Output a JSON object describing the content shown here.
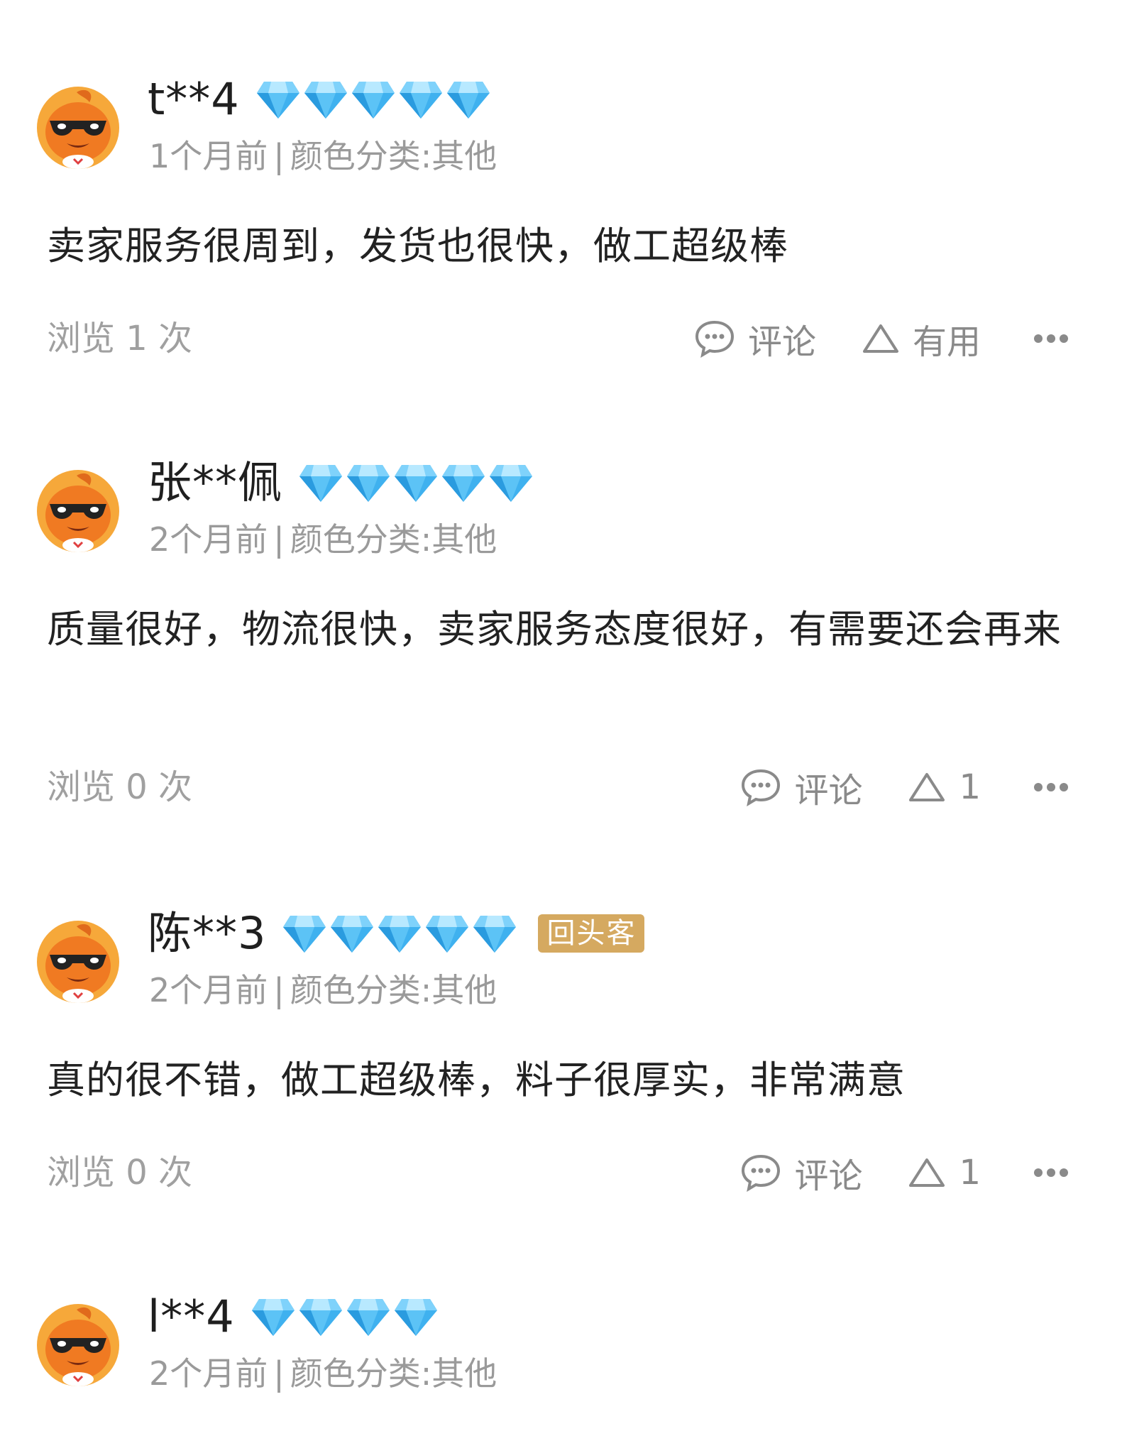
{
  "reviews": [
    {
      "username": "t**4",
      "diamond_count": 5,
      "badge": "",
      "time": "1个月前",
      "separator": "|",
      "variant": "颜色分类:其他",
      "content": "卖家服务很周到，发货也很快，做工超级棒",
      "views": "浏览 1 次",
      "comment_label": "评论",
      "useful_label": "有用"
    },
    {
      "username": "张**佩",
      "diamond_count": 5,
      "badge": "",
      "time": "2个月前",
      "separator": "|",
      "variant": "颜色分类:其他",
      "content": "质量很好，物流很快，卖家服务态度很好，有需要还会再来",
      "views": "浏览 0 次",
      "comment_label": "评论",
      "useful_label": "1"
    },
    {
      "username": "陈**3",
      "diamond_count": 5,
      "badge": "回头客",
      "time": "2个月前",
      "separator": "|",
      "variant": "颜色分类:其他",
      "content": "真的很不错，做工超级棒，料子很厚实，非常满意",
      "views": "浏览 0 次",
      "comment_label": "评论",
      "useful_label": "1"
    },
    {
      "username": "l**4",
      "diamond_count": 4,
      "badge": "",
      "time": "2个月前",
      "separator": "|",
      "variant": "颜色分类:其他"
    }
  ],
  "icons": {
    "avatar": "orange-mascot-sunglasses-avatar",
    "level": "blue-diamond-icon",
    "comment": "speech-bubble-icon",
    "useful": "triangle-up-icon",
    "more": "more-dots-icon"
  },
  "colors": {
    "diamond": "#3fb1ef",
    "badge_bg": "#d5a960",
    "meta_text": "#9a9a9a",
    "avatar_orange": "#f08a2a"
  }
}
